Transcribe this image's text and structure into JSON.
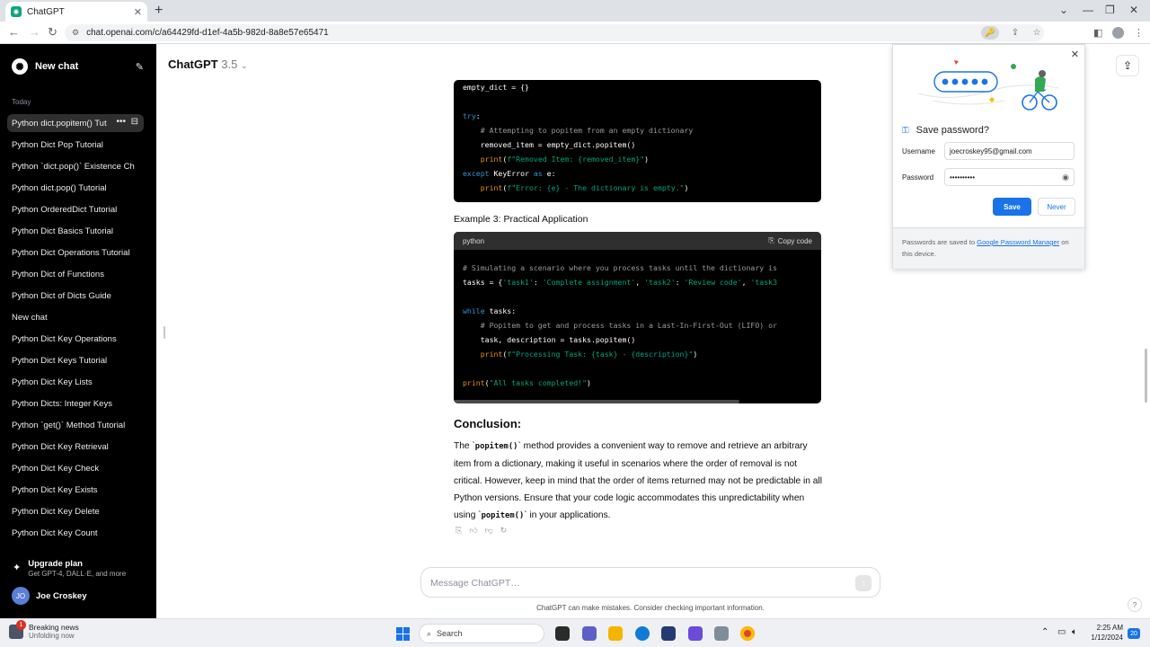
{
  "browser": {
    "tab_title": "ChatGPT",
    "url": "chat.openai.com/c/a64429fd-d1ef-4a5b-982d-8a8e57e65471"
  },
  "sidebar": {
    "new_chat_label": "New chat",
    "section_today": "Today",
    "items": [
      {
        "label": "Python dict.popitem() Tut"
      },
      {
        "label": "Python Dict Pop Tutorial"
      },
      {
        "label": "Python `dict.pop()` Existence Ch"
      },
      {
        "label": "Python dict.pop() Tutorial"
      },
      {
        "label": "Python OrderedDict Tutorial"
      },
      {
        "label": "Python Dict Basics Tutorial"
      },
      {
        "label": "Python Dict Operations Tutorial"
      },
      {
        "label": "Python Dict of Functions"
      },
      {
        "label": "Python Dict of Dicts Guide"
      },
      {
        "label": "New chat"
      },
      {
        "label": "Python Dict Key Operations"
      },
      {
        "label": "Python Dict Keys Tutorial"
      },
      {
        "label": "Python Dict Key Lists"
      },
      {
        "label": "Python Dicts: Integer Keys"
      },
      {
        "label": "Python `get()` Method Tutorial"
      },
      {
        "label": "Python Dict Key Retrieval"
      },
      {
        "label": "Python Dict Key Check"
      },
      {
        "label": "Python Dict Key Exists"
      },
      {
        "label": "Python Dict Key Delete"
      },
      {
        "label": "Python Dict Key Count"
      }
    ],
    "upgrade_title": "Upgrade plan",
    "upgrade_sub": "Get GPT-4, DALL·E, and more",
    "user_initials": "JO",
    "user_name": "Joe Croskey"
  },
  "main": {
    "model_name": "ChatGPT",
    "model_version": "3.5",
    "code1": {
      "lines": [
        {
          "parts": [
            {
              "t": "empty_dict = {}",
              "c": ""
            }
          ]
        },
        {
          "parts": [
            {
              "t": "",
              "c": ""
            }
          ]
        },
        {
          "parts": [
            {
              "t": "try",
              "c": "kw"
            },
            {
              "t": ":",
              "c": ""
            }
          ]
        },
        {
          "parts": [
            {
              "t": "    # Attempting to popitem from an empty dictionary",
              "c": "cm"
            }
          ]
        },
        {
          "parts": [
            {
              "t": "    removed_item = empty_dict.popitem()",
              "c": ""
            }
          ]
        },
        {
          "parts": [
            {
              "t": "    ",
              "c": ""
            },
            {
              "t": "print",
              "c": "fn"
            },
            {
              "t": "(",
              "c": ""
            },
            {
              "t": "f\"Removed Item: {removed_item}\"",
              "c": "st"
            },
            {
              "t": ")",
              "c": ""
            }
          ]
        },
        {
          "parts": [
            {
              "t": "except",
              "c": "kw"
            },
            {
              "t": " KeyError ",
              "c": ""
            },
            {
              "t": "as",
              "c": "kw"
            },
            {
              "t": " e:",
              "c": ""
            }
          ]
        },
        {
          "parts": [
            {
              "t": "    ",
              "c": ""
            },
            {
              "t": "print",
              "c": "fn"
            },
            {
              "t": "(",
              "c": ""
            },
            {
              "t": "f\"Error: {e} - The dictionary is empty.\"",
              "c": "st"
            },
            {
              "t": ")",
              "c": ""
            }
          ]
        }
      ]
    },
    "example3_label": "Example 3: Practical Application",
    "code2": {
      "language": "python",
      "copy_label": "Copy code",
      "lines": [
        {
          "parts": [
            {
              "t": "# Simulating a scenario where you process tasks until the dictionary is",
              "c": "cm"
            }
          ]
        },
        {
          "parts": [
            {
              "t": "tasks = {",
              "c": ""
            },
            {
              "t": "'task1'",
              "c": "st"
            },
            {
              "t": ": ",
              "c": ""
            },
            {
              "t": "'Complete assignment'",
              "c": "st"
            },
            {
              "t": ", ",
              "c": ""
            },
            {
              "t": "'task2'",
              "c": "st"
            },
            {
              "t": ": ",
              "c": ""
            },
            {
              "t": "'Review code'",
              "c": "st"
            },
            {
              "t": ", ",
              "c": ""
            },
            {
              "t": "'task3",
              "c": "st"
            }
          ]
        },
        {
          "parts": [
            {
              "t": "",
              "c": ""
            }
          ]
        },
        {
          "parts": [
            {
              "t": "while",
              "c": "kw"
            },
            {
              "t": " tasks:",
              "c": ""
            }
          ]
        },
        {
          "parts": [
            {
              "t": "    # Popitem to get and process tasks in a Last-In-First-Out (LIFO) or",
              "c": "cm"
            }
          ]
        },
        {
          "parts": [
            {
              "t": "    task, description = tasks.popitem()",
              "c": ""
            }
          ]
        },
        {
          "parts": [
            {
              "t": "    ",
              "c": ""
            },
            {
              "t": "print",
              "c": "fn"
            },
            {
              "t": "(",
              "c": ""
            },
            {
              "t": "f\"Processing Task: {task} - {description}\"",
              "c": "st"
            },
            {
              "t": ")",
              "c": ""
            }
          ]
        },
        {
          "parts": [
            {
              "t": "",
              "c": ""
            }
          ]
        },
        {
          "parts": [
            {
              "t": "print",
              "c": "fn"
            },
            {
              "t": "(",
              "c": ""
            },
            {
              "t": "\"All tasks completed!\"",
              "c": "st"
            },
            {
              "t": ")",
              "c": ""
            }
          ]
        }
      ]
    },
    "conclusion_heading": "Conclusion:",
    "conclusion": {
      "p1": "The `",
      "c1": "popitem()",
      "p2": "` method provides a convenient way to remove and retrieve an arbitrary item from a dictionary, making it useful in scenarios where the order of removal is not critical. However, keep in mind that the order of items returned may not be predictable in all Python versions. Ensure that your code logic accommodates this unpredictability when using `",
      "c2": "popitem()",
      "p3": "` in your applications."
    },
    "composer_placeholder": "Message ChatGPT…",
    "disclaimer": "ChatGPT can make mistakes. Consider checking important information.",
    "help": "?"
  },
  "password_popup": {
    "title": "Save password?",
    "username_label": "Username",
    "username_value": "joecroskey95@gmail.com",
    "password_label": "Password",
    "password_value": "••••••••••",
    "save_label": "Save",
    "never_label": "Never",
    "footer_pre": "Passwords are saved to ",
    "footer_link": "Google Password Manager",
    "footer_post": " on this device."
  },
  "taskbar": {
    "news_title": "Breaking news",
    "news_sub": "Unfolding now",
    "news_badge": "1",
    "search_label": "Search",
    "time": "2:25 AM",
    "date": "1/12/2024",
    "notif_count": "20"
  },
  "colors": {
    "sidebar_bg": "#000000",
    "accent_blue": "#1a73e8",
    "code_string": "#00a67d",
    "code_keyword": "#2e95d3",
    "code_function": "#e9950c"
  }
}
